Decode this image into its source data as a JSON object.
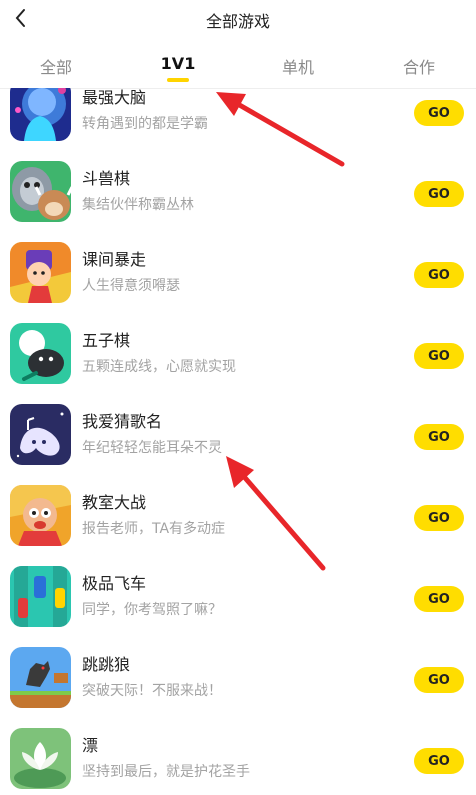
{
  "header": {
    "title": "全部游戏",
    "back_icon": "chevron-left-icon"
  },
  "tabs": [
    {
      "label": "全部",
      "active": false
    },
    {
      "label": "1V1",
      "active": true
    },
    {
      "label": "单机",
      "active": false
    },
    {
      "label": "合作",
      "active": false
    }
  ],
  "colors": {
    "accent": "#ffdd00",
    "annotation_arrow": "#e8262a"
  },
  "games": [
    {
      "name": "最强大脑",
      "desc": "转角遇到的都是学霸",
      "button": "GO",
      "icon": "brain-icon"
    },
    {
      "name": "斗兽棋",
      "desc": "集结伙伴称霸丛林",
      "button": "GO",
      "icon": "animal-chess-icon"
    },
    {
      "name": "课间暴走",
      "desc": "人生得意须嘚瑟",
      "button": "GO",
      "icon": "running-boy-icon"
    },
    {
      "name": "五子棋",
      "desc": "五颗连成线，心愿就实现",
      "button": "GO",
      "icon": "gomoku-icon"
    },
    {
      "name": "我爱猜歌名",
      "desc": "年纪轻轻怎能耳朵不灵",
      "button": "GO",
      "icon": "music-note-icon"
    },
    {
      "name": "教室大战",
      "desc": "报告老师，TA有多动症",
      "button": "GO",
      "icon": "classroom-battle-icon"
    },
    {
      "name": "极品飞车",
      "desc": "同学，你考驾照了嘛？",
      "button": "GO",
      "icon": "racing-car-icon"
    },
    {
      "name": "跳跳狼",
      "desc": "突破天际！不服来战！",
      "button": "GO",
      "icon": "jumping-wolf-icon"
    },
    {
      "name": "漂",
      "desc": "坚持到最后，就是护花圣手",
      "button": "GO",
      "icon": "lotus-flower-icon"
    }
  ]
}
